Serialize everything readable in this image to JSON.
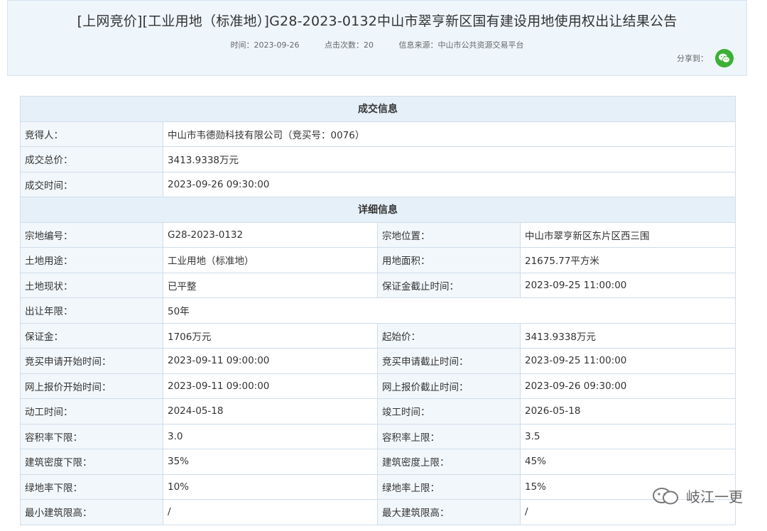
{
  "header": {
    "title": "[上网竞价][工业用地（标准地）]G28-2023-0132中山市翠亨新区国有建设用地使用权出让结果公告",
    "time": "时间：2023-09-26",
    "clicks": "点击次数：20",
    "source": "信息来源：中山市公共资源交易平台",
    "share_label": "分享到：",
    "share_icon": "wechat-icon"
  },
  "deal": {
    "section_title": "成交信息",
    "rows": [
      {
        "label": "竞得人：",
        "value": "中山市韦德勋科技有限公司（竞买号：0076）"
      },
      {
        "label": "成交总价：",
        "value": "3413.9338万元"
      },
      {
        "label": "成交时间：",
        "value": "2023-09-26 09:30:00"
      }
    ]
  },
  "detail": {
    "section_title": "详细信息",
    "rows": [
      {
        "l1": "宗地编号：",
        "v1": "G28-2023-0132",
        "l2": "宗地位置：",
        "v2": "中山市翠亨新区东片区西三围"
      },
      {
        "l1": "土地用途：",
        "v1": "工业用地（标准地）",
        "l2": "用地面积：",
        "v2": "21675.77平方米"
      },
      {
        "l1": "土地现状：",
        "v1": "已平整",
        "l2": "保证金截止时间：",
        "v2": "2023-09-25 11:00:00"
      },
      {
        "l1": "出让年限：",
        "v1": "50年"
      },
      {
        "l1": "保证金：",
        "v1": "1706万元",
        "l2": "起始价：",
        "v2": "3413.9338万元"
      },
      {
        "l1": "竞买申请开始时间：",
        "v1": "2023-09-11 09:00:00",
        "l2": "竞买申请截止时间：",
        "v2": "2023-09-25 11:00:00"
      },
      {
        "l1": "网上报价开始时间：",
        "v1": "2023-09-11 09:00:00",
        "l2": "网上报价截止时间：",
        "v2": "2023-09-26 09:30:00"
      },
      {
        "l1": "动工时间：",
        "v1": "2024-05-18",
        "l2": "竣工时间：",
        "v2": "2026-05-18"
      },
      {
        "l1": "容积率下限：",
        "v1": "3.0",
        "l2": "容积率上限：",
        "v2": "3.5"
      },
      {
        "l1": "建筑密度下限：",
        "v1": "35%",
        "l2": "建筑密度上限：",
        "v2": "45%"
      },
      {
        "l1": "绿地率下限：",
        "v1": "10%",
        "l2": "绿地率上限：",
        "v2": "15%"
      },
      {
        "l1": "最小建筑限高：",
        "v1": "/",
        "l2": "最大建筑限高：",
        "v2": "/"
      }
    ]
  },
  "watermark": {
    "text": "岐江一更",
    "icon": "wechat-watermark-icon"
  }
}
